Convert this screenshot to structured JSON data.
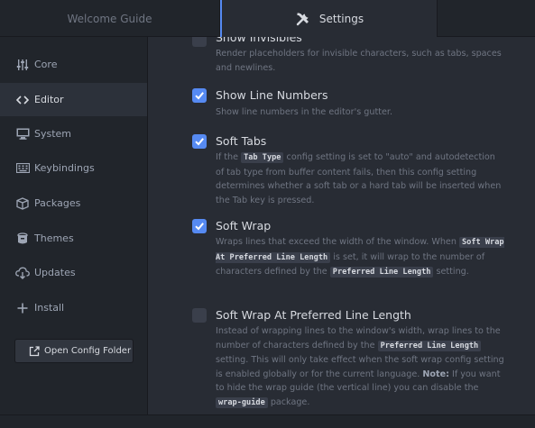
{
  "tabs": [
    {
      "label": "Welcome Guide",
      "active": false
    },
    {
      "label": "Settings",
      "active": true,
      "icon": "tools-icon"
    }
  ],
  "sidebar": {
    "items": [
      {
        "label": "Core",
        "icon": "sliders-icon",
        "active": false
      },
      {
        "label": "Editor",
        "icon": "code-icon",
        "active": true
      },
      {
        "label": "System",
        "icon": "device-desktop-icon",
        "active": false
      },
      {
        "label": "Keybindings",
        "icon": "keyboard-icon",
        "active": false
      },
      {
        "label": "Packages",
        "icon": "package-icon",
        "active": false
      },
      {
        "label": "Themes",
        "icon": "paintcan-icon",
        "active": false
      },
      {
        "label": "Updates",
        "icon": "cloud-download-icon",
        "active": false
      },
      {
        "label": "Install",
        "icon": "plus-icon",
        "active": false
      }
    ],
    "config_button": "Open Config Folder"
  },
  "settings": {
    "show_invisibles": {
      "title": "Show Invisibles",
      "checked": false,
      "desc": "Render placeholders for invisible characters, such as tabs, spaces and newlines."
    },
    "show_line_numbers": {
      "title": "Show Line Numbers",
      "checked": true,
      "desc": "Show line numbers in the editor's gutter."
    },
    "soft_tabs": {
      "title": "Soft Tabs",
      "checked": true,
      "desc_1": "If the",
      "code_1": "Tab Type",
      "desc_2": "config setting is set to \"auto\" and autodetection of tab type from buffer content fails, then this config setting determines whether a soft tab or a hard tab will be inserted when the Tab key is pressed."
    },
    "soft_wrap": {
      "title": "Soft Wrap",
      "checked": true,
      "desc_1": "Wraps lines that exceed the width of the window. When",
      "code_1": "Soft Wrap At Preferred Line Length",
      "desc_2": "is set, it will wrap to the number of characters defined by the",
      "code_2": "Preferred Line Length",
      "desc_3": "setting."
    },
    "soft_wrap_preferred": {
      "title": "Soft Wrap At Preferred Line Length",
      "checked": false,
      "desc_1": "Instead of wrapping lines to the window's width, wrap lines to the number of characters defined by the",
      "code_1": "Preferred Line Length",
      "desc_2": "setting. This will only take effect when the soft wrap config setting is enabled globally or for the current language.",
      "note_label": "Note:",
      "desc_3": "If you want to hide the wrap guide (the vertical line) you can disable the",
      "code_2": "wrap-guide",
      "desc_4": "package."
    }
  },
  "colors": {
    "accent": "#568af2",
    "sidebar_bg": "#21252b",
    "panel_bg": "#282c34",
    "text_primary": "#d7dae0",
    "text_muted": "#6f7582"
  }
}
